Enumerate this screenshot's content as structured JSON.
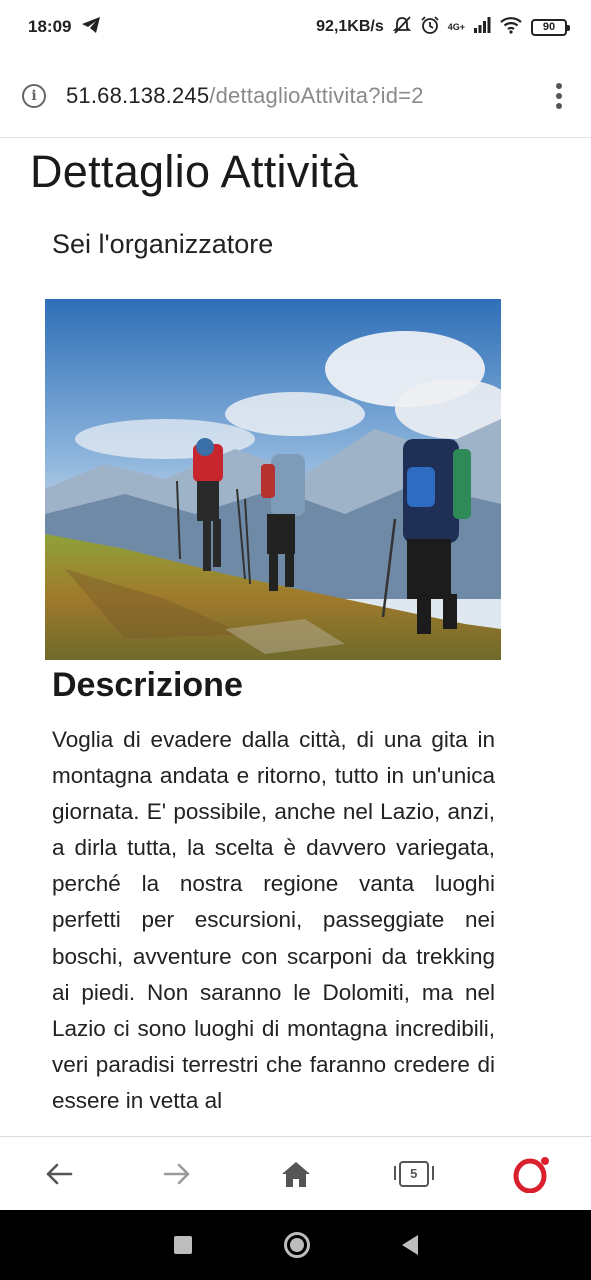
{
  "status_bar": {
    "time": "18:09",
    "net_speed": "92,1KB/s",
    "net_type": "4G+",
    "battery": "90",
    "icons": [
      "telegram-icon",
      "mute-icon",
      "alarm-icon",
      "signal-icon",
      "wifi-icon",
      "battery-icon"
    ]
  },
  "browser": {
    "url_host": "51.68.138.245",
    "url_path": "/dettaglioAttivita?id=2",
    "tab_count": "5",
    "icons": [
      "info-icon",
      "menu-icon",
      "back-icon",
      "forward-icon",
      "home-icon",
      "tabs-icon",
      "opera-icon"
    ],
    "colors": {
      "opera_red": "#d9202c",
      "toolbar_icon": "#555555",
      "url_path": "#8a8a8a"
    }
  },
  "page": {
    "title": "Dettaglio Attività",
    "organizer_text": "Sei l'organizzatore",
    "image": {
      "subject": "hikers-on-mountain-meadow"
    },
    "description_heading": "Descrizione",
    "description_text": "Voglia di evadere dalla città, di una gita in montagna andata e ritorno, tutto in un'unica giornata. E' possibile, anche nel Lazio, anzi, a dirla tutta, la scelta è davvero variegata, perché la nostra regione vanta luoghi perfetti per escursioni, passeggiate nei boschi, avventure con scarponi da trekking ai piedi. Non saranno le Dolomiti, ma nel Lazio ci sono luoghi di montagna incredibili, veri paradisi terrestri che faranno credere di essere in vetta al"
  },
  "android_nav": {
    "icons": [
      "recents-icon",
      "home-circle-icon",
      "back-triangle-icon"
    ]
  }
}
